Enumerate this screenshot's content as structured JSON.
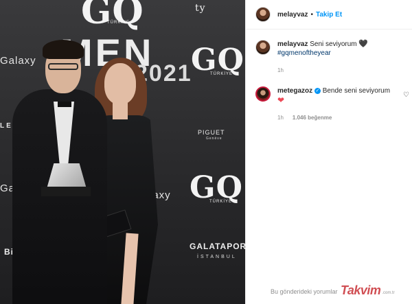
{
  "photo": {
    "wall": {
      "gq": "GQ",
      "turkiye": "TÜRKİYE",
      "men": "MEN",
      "year": "2021",
      "galaxy": "Galaxy",
      "lexus": "LE",
      "piguet": "PIGUET",
      "geneve": "Genève",
      "galataport": "GALATAPORT",
      "istanbul": "İSTANBUL",
      "bifi": "Bif",
      "ty": "ty"
    }
  },
  "header": {
    "username": "melayvaz",
    "separator": "•",
    "follow_label": "Takip Et"
  },
  "caption": {
    "username": "melayvaz",
    "text": "Seni seviyorum",
    "heart": "🖤",
    "hashtag": "#gqmenoftheyear",
    "time": "1h"
  },
  "reply": {
    "username": "metegazoz",
    "verified_mark": "✓",
    "text": "Bende seni seviyorum",
    "heart": "❤",
    "time": "1h",
    "likes": "1.046 beğenme",
    "like_icon": "heart-outline-icon",
    "like_glyph": "♡"
  },
  "footer": {
    "note": "Bu gönderideki yorumlar",
    "watermark": "Takvim",
    "watermark_suffix": ".com.tr"
  },
  "colors": {
    "follow": "#0095f6",
    "hashtag": "#00376b",
    "heart_red": "#ed4956",
    "meta": "#8e8e8e"
  }
}
